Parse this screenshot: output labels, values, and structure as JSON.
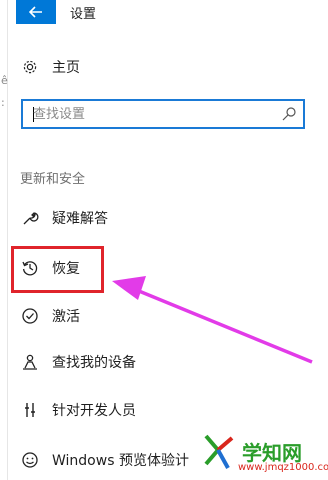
{
  "window": {
    "title": "设置"
  },
  "nav": {
    "home_label": "主页",
    "section_title": "更新和安全",
    "items": [
      {
        "label": "疑难解答",
        "icon": "wrench-icon"
      },
      {
        "label": "恢复",
        "icon": "history-icon"
      },
      {
        "label": "激活",
        "icon": "check-circle-icon"
      },
      {
        "label": "查找我的设备",
        "icon": "person-pin-icon"
      },
      {
        "label": "针对开发人员",
        "icon": "developer-tools-icon"
      },
      {
        "label": "Windows 预览体验计",
        "icon": "smiley-icon"
      }
    ]
  },
  "search": {
    "placeholder": "查找设置"
  },
  "watermark": {
    "title": "学知网",
    "url": "www.jmqz1000.com"
  },
  "colors": {
    "accent": "#0078d7",
    "highlight": "#e0242b",
    "arrow": "#e23be8",
    "watermark_green": "#2a9d2a"
  }
}
